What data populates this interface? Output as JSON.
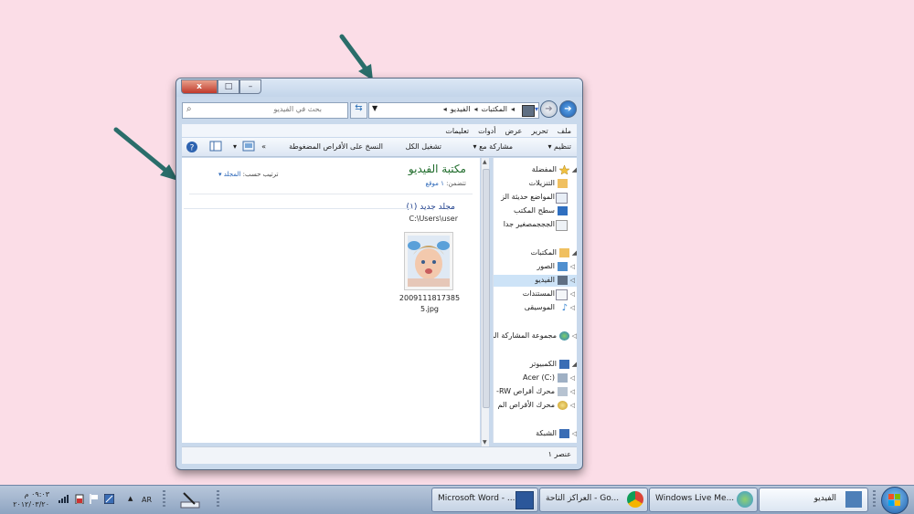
{
  "window": {
    "caption_buttons": {
      "close": "x",
      "maximize": "□",
      "minimize": "–"
    },
    "search_placeholder": "بحث في الفيديو",
    "breadcrumb": [
      "المكتبات",
      "الفيديو"
    ],
    "menu": [
      "ملف",
      "تحرير",
      "عرض",
      "أدوات",
      "تعليمات"
    ],
    "toolbar": {
      "organize": "تنظيم",
      "share": "مشاركة مع",
      "play_all": "تشغيل الكل",
      "burn": "النسخ على الأقراص المضغوطة",
      "more": "»"
    },
    "nav": {
      "favorites": "المفضلة",
      "downloads": "التنزيلات",
      "recent_places": "المواضع حديثة الز",
      "desktop": "سطح المكتب",
      "tiny": "الجججمصغير جدا",
      "libraries": "المكتبات",
      "pictures": "الصور",
      "videos": "الفيديو",
      "documents": "المستندات",
      "music": "الموسيقى",
      "homegroup": "مجموعة المشاركة الم",
      "computer": "الكمبيوتر",
      "drive_c": "Acer (C:)",
      "drive_rw": "محرك أقراص RW-",
      "drive_dvd": "محرك الأقراص الم",
      "network": "الشبكة"
    },
    "library": {
      "title": "مكتبة الفيديو",
      "includes_label": "تتضمن:",
      "includes_link": "١ موقع",
      "arrange_label": "ترتيب حسب:",
      "arrange_value": "المجلد"
    },
    "group": {
      "header": "مجلد جديد (١)",
      "path": "C:\\Users\\user"
    },
    "file": {
      "name": "20091118173855.jpg"
    },
    "status": "عنصر ١"
  },
  "taskbar": {
    "buttons": [
      {
        "label": "الفيديو",
        "icon": "explorer-icon"
      },
      {
        "label": "Windows Live Me...",
        "icon": "messenger-icon"
      },
      {
        "label": "العراكز التاحة - Go...",
        "icon": "chrome-icon"
      },
      {
        "label": "Microsoft Word - ...",
        "icon": "word-icon"
      }
    ],
    "lang": "AR",
    "time": "٠٩:٠٣ م",
    "date": "٢٠١٢/٠٣/٢٠",
    "tray_expand": "▲"
  },
  "colors": {
    "background": "#fbdde7",
    "arrow": "#2a6d6a",
    "window_frame": "#c9d9ec",
    "library_title": "#1e6b2a",
    "link": "#2a66b8"
  }
}
